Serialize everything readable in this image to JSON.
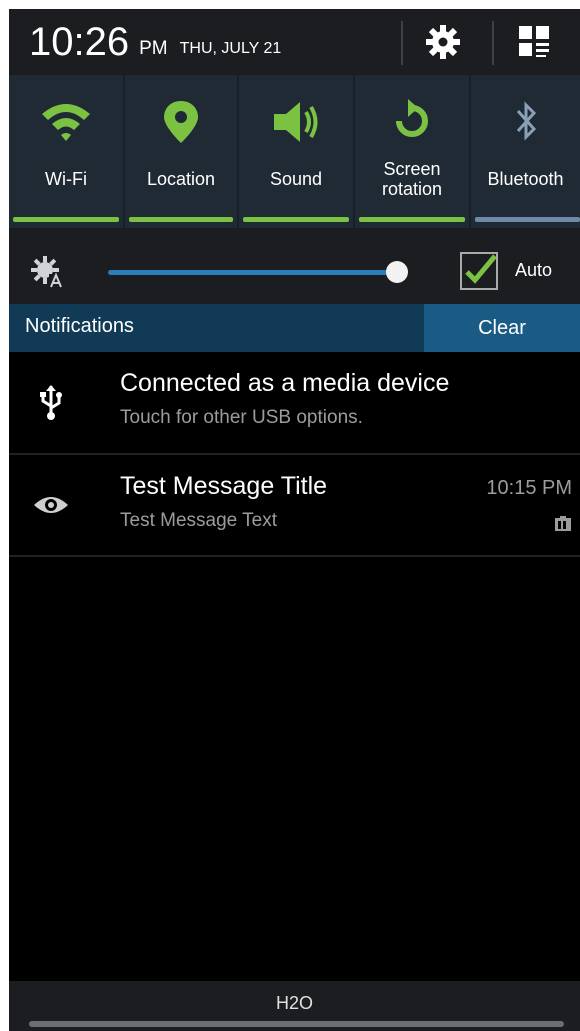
{
  "status": {
    "time": "10:26",
    "ampm": "PM",
    "date": "THU, JULY 21"
  },
  "quick_settings": [
    {
      "label": "Wi-Fi",
      "icon": "wifi-icon",
      "active": true
    },
    {
      "label": "Location",
      "icon": "location-pin-icon",
      "active": true
    },
    {
      "label": "Sound",
      "icon": "speaker-icon",
      "active": true
    },
    {
      "label": "Screen\nrotation",
      "icon": "rotation-icon",
      "active": true
    },
    {
      "label": "Bluetooth",
      "icon": "bluetooth-icon",
      "active": false
    }
  ],
  "brightness": {
    "level": 0.94,
    "auto_checked": true,
    "auto_label": "Auto"
  },
  "notifications": {
    "header_label": "Notifications",
    "clear_label": "Clear",
    "items": [
      {
        "icon": "usb-icon",
        "title": "Connected as a media device",
        "text": "Touch for other USB options.",
        "time": ""
      },
      {
        "icon": "eye-icon",
        "title": "Test Message Title",
        "text": "Test Message Text",
        "time": "10:15 PM"
      }
    ]
  },
  "carrier": "H2O",
  "colors": {
    "active_bar": "#7cc242",
    "inactive_bar": "#6f8aa6",
    "accent_green": "#7cc242",
    "slider_blue": "#2b7fb6"
  }
}
